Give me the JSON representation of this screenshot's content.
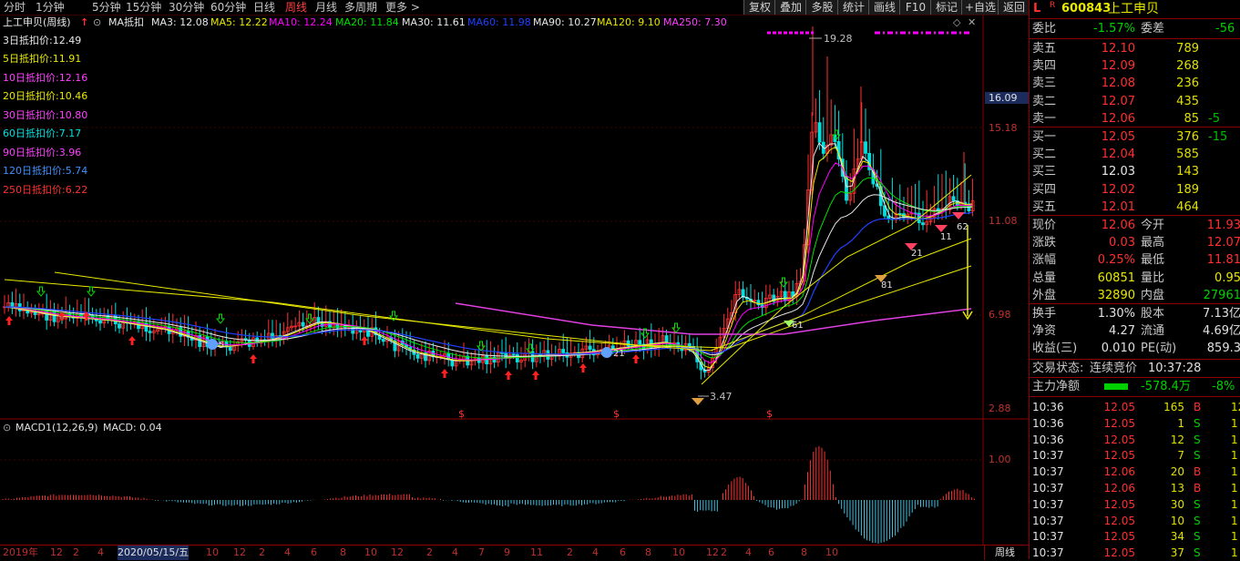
{
  "toolbar": {
    "periods": [
      "分时",
      "1分钟",
      "5分钟",
      "15分钟",
      "30分钟",
      "60分钟",
      "日线",
      "周线",
      "月线",
      "多周期",
      "更多 >"
    ],
    "active_index": 7,
    "right_buttons": [
      "复权",
      "叠加",
      "多股",
      "统计",
      "画线",
      "F10",
      "标记",
      "+自选",
      "返回"
    ]
  },
  "legend": {
    "title": "上工申贝(周线)",
    "indicator": "MA抵扣",
    "items": [
      {
        "text": "MA3: 12.08",
        "color": "#e8e8e8"
      },
      {
        "text": "MA5: 12.22",
        "color": "#e8e800"
      },
      {
        "text": "MA10: 12.24",
        "color": "#ff00ff"
      },
      {
        "text": "MA20: 11.84",
        "color": "#00e000"
      },
      {
        "text": "MA30: 11.61",
        "color": "#e8e8e8"
      },
      {
        "text": "MA60: 11.98",
        "color": "#2040ff"
      },
      {
        "text": "MA90: 10.27",
        "color": "#e8e8e8"
      },
      {
        "text": "MA120: 9.10",
        "color": "#e8e800"
      },
      {
        "text": "MA250: 7.30",
        "color": "#ff40ff"
      }
    ]
  },
  "deduct": [
    {
      "text": "3日抵扣价:12.49",
      "color": "#e8e8e8"
    },
    {
      "text": "5日抵扣价:11.91",
      "color": "#e8e800"
    },
    {
      "text": "10日抵扣价:12.16",
      "color": "#ff40ff"
    },
    {
      "text": "20日抵扣价:10.46",
      "color": "#e8e800"
    },
    {
      "text": "30日抵扣价:10.80",
      "color": "#ff40ff"
    },
    {
      "text": "60日抵扣价:7.17",
      "color": "#00e0e0"
    },
    {
      "text": "90日抵扣价:3.96",
      "color": "#ff40ff"
    },
    {
      "text": "120日抵扣价:5.74",
      "color": "#4090ff"
    },
    {
      "text": "250日抵扣价:6.22",
      "color": "#ff3030"
    }
  ],
  "yaxis": [
    "16.09",
    "15.18",
    "11.08",
    "6.98",
    "2.88"
  ],
  "price_high_label": "19.28",
  "price_low_label": "3.47",
  "markers": [
    "5",
    "21",
    "61",
    "81",
    "21",
    "11",
    "62"
  ],
  "macd": {
    "label": "MACD1(12,26,9)",
    "value": "MACD: 0.04",
    "ytick": "1.00"
  },
  "dates": [
    "2019年",
    "12",
    "2",
    "4",
    "2020/05/15/五",
    "10",
    "12",
    "2",
    "4",
    "6",
    "8",
    "10",
    "12",
    "2",
    "4",
    "7",
    "9",
    "11",
    "2",
    "4",
    "6",
    "8",
    "10",
    "12",
    "2",
    "4",
    "6",
    "8",
    "10"
  ],
  "period_label": "周线",
  "stock": {
    "flag": "L",
    "sup": "R",
    "code": "600843",
    "name": "上工申贝"
  },
  "weibi": {
    "label1": "委比",
    "value1": "-1.57%",
    "label2": "委差",
    "value2": "-56"
  },
  "sell": [
    {
      "label": "卖五",
      "price": "12.10",
      "vol": "789",
      "chg": ""
    },
    {
      "label": "卖四",
      "price": "12.09",
      "vol": "268",
      "chg": ""
    },
    {
      "label": "卖三",
      "price": "12.08",
      "vol": "236",
      "chg": ""
    },
    {
      "label": "卖二",
      "price": "12.07",
      "vol": "435",
      "chg": ""
    },
    {
      "label": "卖一",
      "price": "12.06",
      "vol": "85",
      "chg": "-5"
    }
  ],
  "buy": [
    {
      "label": "买一",
      "price": "12.05",
      "vol": "376",
      "chg": "-15"
    },
    {
      "label": "买二",
      "price": "12.04",
      "vol": "585",
      "chg": ""
    },
    {
      "label": "买三",
      "price": "12.03",
      "vol": "143",
      "chg": ""
    },
    {
      "label": "买四",
      "price": "12.02",
      "vol": "189",
      "chg": ""
    },
    {
      "label": "买五",
      "price": "12.01",
      "vol": "464",
      "chg": ""
    }
  ],
  "quote": [
    {
      "l1": "现价",
      "v1": "12.06",
      "l2": "今开",
      "v2": "11.93"
    },
    {
      "l1": "涨跌",
      "v1": "0.03",
      "l2": "最高",
      "v2": "12.07"
    },
    {
      "l1": "涨幅",
      "v1": "0.25%",
      "l2": "最低",
      "v2": "11.81"
    },
    {
      "l1": "总量",
      "v1": "60851",
      "l2": "量比",
      "v2": "0.95"
    },
    {
      "l1": "外盘",
      "v1": "32890",
      "l2": "内盘",
      "v2": "27961"
    }
  ],
  "fund": [
    {
      "l1": "换手",
      "v1": "1.30%",
      "l2": "股本",
      "v2": "7.13亿"
    },
    {
      "l1": "净资",
      "v1": "4.27",
      "l2": "流通",
      "v2": "4.69亿"
    },
    {
      "l1": "收益(三)",
      "v1": "0.010",
      "l2": "PE(动)",
      "v2": "859.3"
    }
  ],
  "status": {
    "label": "交易状态:",
    "value": "连续竞价",
    "time": "10:37:28"
  },
  "mainflow": {
    "label": "主力净额",
    "value": "-578.4万",
    "pct": "-8%"
  },
  "ticks": [
    {
      "t": "10:36",
      "p": "12.05",
      "v": "165",
      "d": "B",
      "x": "12"
    },
    {
      "t": "10:36",
      "p": "12.05",
      "v": "1",
      "d": "S",
      "x": "1"
    },
    {
      "t": "10:36",
      "p": "12.05",
      "v": "12",
      "d": "S",
      "x": "1"
    },
    {
      "t": "10:37",
      "p": "12.05",
      "v": "7",
      "d": "S",
      "x": "1"
    },
    {
      "t": "10:37",
      "p": "12.06",
      "v": "20",
      "d": "B",
      "x": "1"
    },
    {
      "t": "10:37",
      "p": "12.06",
      "v": "13",
      "d": "B",
      "x": "1"
    },
    {
      "t": "10:37",
      "p": "12.05",
      "v": "30",
      "d": "S",
      "x": "1"
    },
    {
      "t": "10:37",
      "p": "12.05",
      "v": "10",
      "d": "S",
      "x": "1"
    },
    {
      "t": "10:37",
      "p": "12.05",
      "v": "34",
      "d": "S",
      "x": "1"
    },
    {
      "t": "10:37",
      "p": "12.05",
      "v": "37",
      "d": "S",
      "x": "1"
    }
  ]
}
